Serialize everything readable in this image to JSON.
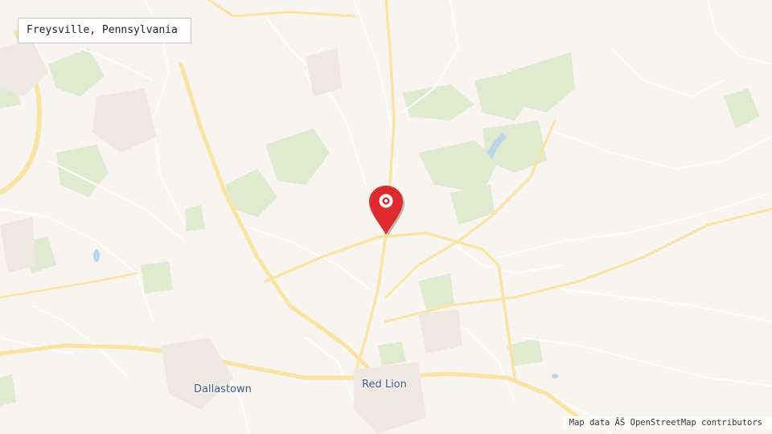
{
  "map": {
    "title": "Freysville, Pennsylvania",
    "attribution": "Map data ÂŠ OpenStreetMap contributors",
    "places": [
      {
        "name": "Dallastown"
      },
      {
        "name": "Red Lion"
      }
    ],
    "marker": {
      "icon": "map-pin-icon",
      "color": "#e02a2e"
    },
    "colors": {
      "background": "#f8f4ef",
      "road_major": "#fbe3a0",
      "road_minor": "#ffffff",
      "park": "#dfeacf",
      "water": "#b9d6ea",
      "label": "#3d5a80"
    }
  }
}
